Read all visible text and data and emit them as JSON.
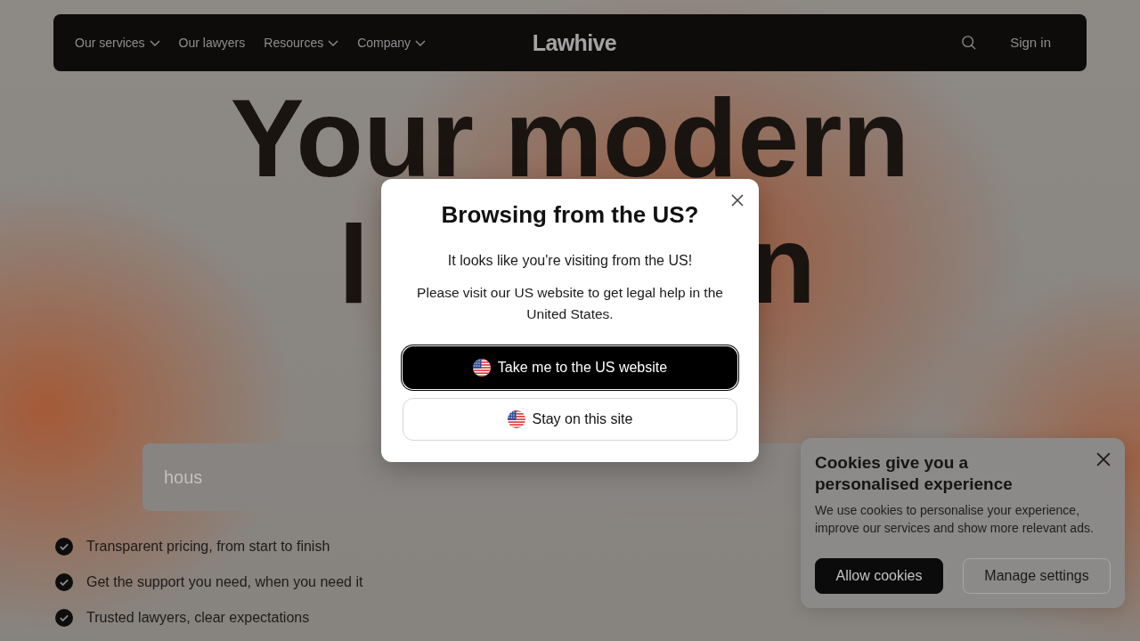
{
  "navbar": {
    "items": [
      {
        "label": "Our services",
        "has_dropdown": true
      },
      {
        "label": "Our lawyers",
        "has_dropdown": false
      },
      {
        "label": "Resources",
        "has_dropdown": true
      },
      {
        "label": "Company",
        "has_dropdown": true
      }
    ],
    "logo": "Lawhive",
    "sign_in": "Sign in"
  },
  "hero": {
    "heading_line_1": "Your modern",
    "heading_line_2_fragments": [
      "l",
      "n"
    ],
    "search": {
      "placeholder": "hous"
    },
    "features": [
      "Transparent pricing, from start to finish",
      "Get the support you need, when you need it",
      "Trusted lawyers, clear expectations"
    ]
  },
  "dialog": {
    "title": "Browsing from the US?",
    "message": "It looks like you're visiting from the US!",
    "detail": "Please visit our US website to get legal help in the United States.",
    "buttons": [
      {
        "label": "Take me to the US website",
        "kind": "primary"
      },
      {
        "label": "Stay on this site",
        "kind": "secondary"
      }
    ]
  },
  "cookie_banner": {
    "title": "Cookies give you a personalised experience",
    "body": "We use cookies to personalise your experience, improve our services and show more relevant ads.",
    "buttons": [
      {
        "label": "Allow cookies",
        "kind": "primary"
      },
      {
        "label": "Manage settings",
        "kind": "secondary"
      }
    ]
  }
}
